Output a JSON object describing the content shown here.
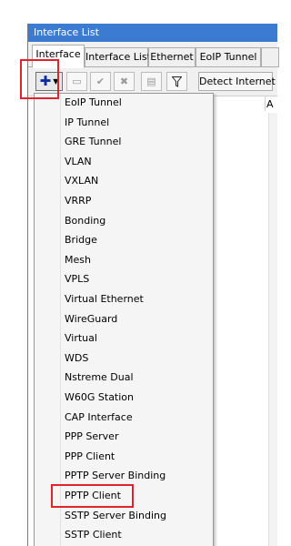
{
  "window": {
    "title": "Interface List"
  },
  "tabs": [
    {
      "label": "Interface",
      "active": true
    },
    {
      "label": "Interface List",
      "active": false
    },
    {
      "label": "Ethernet",
      "active": false
    },
    {
      "label": "EoIP Tunnel",
      "active": false
    }
  ],
  "toolbar": {
    "buttons": [
      {
        "icon": "plus-dropdown-icon",
        "enabled": true
      },
      {
        "icon": "minus-icon",
        "enabled": false
      },
      {
        "icon": "check-icon",
        "enabled": false
      },
      {
        "icon": "cross-icon",
        "enabled": false
      },
      {
        "icon": "comment-icon",
        "enabled": false
      },
      {
        "icon": "filter-icon",
        "enabled": true
      }
    ],
    "detect_label": "Detect Internet"
  },
  "grid": {
    "col_a": "A"
  },
  "menu": {
    "items": [
      "EoIP Tunnel",
      "IP Tunnel",
      "GRE Tunnel",
      "VLAN",
      "VXLAN",
      "VRRP",
      "Bonding",
      "Bridge",
      "Mesh",
      "VPLS",
      "Virtual Ethernet",
      "WireGuard",
      "Virtual",
      "WDS",
      "Nstreme Dual",
      "W60G Station",
      "CAP Interface",
      "PPP Server",
      "PPP Client",
      "PPTP Server Binding",
      "PPTP Client",
      "SSTP Server Binding",
      "SSTP Client"
    ],
    "highlighted": "PPTP Client"
  },
  "colors": {
    "title_bar": "#3c7bd2",
    "highlight": "#e0232b",
    "add_icon": "#0a2da0"
  }
}
